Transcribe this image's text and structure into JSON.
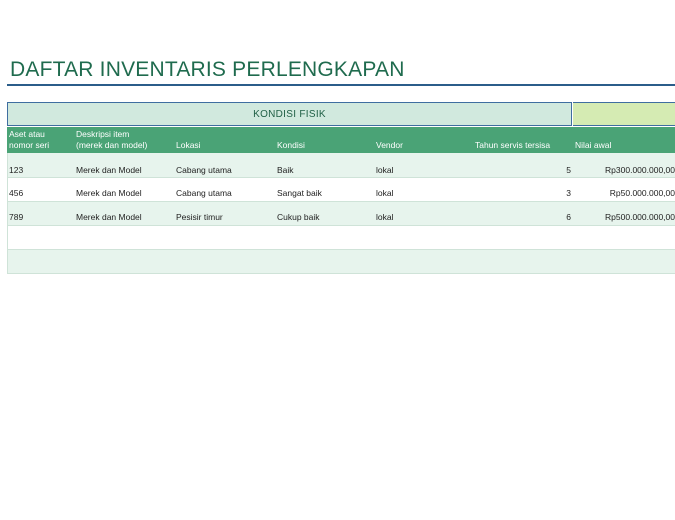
{
  "title": "DAFTAR INVENTARIS PERLENGKAPAN",
  "group_header": "KONDISI FISIK",
  "columns": [
    {
      "line1": "Aset atau",
      "line2": "nomor seri"
    },
    {
      "line1": "Deskripsi item",
      "line2": "(merek dan model)"
    },
    {
      "line1": "",
      "line2": "Lokasi"
    },
    {
      "line1": "",
      "line2": "Kondisi"
    },
    {
      "line1": "",
      "line2": "Vendor"
    },
    {
      "line1": "",
      "line2": "Tahun servis tersisa"
    },
    {
      "line1": "",
      "line2": "Nilai awal"
    }
  ],
  "rows": [
    {
      "asset": "123",
      "desc": "Merek dan Model",
      "location": "Cabang utama",
      "condition": "Baik",
      "vendor": "lokal",
      "years": "5",
      "value": "Rp300.000.000,00"
    },
    {
      "asset": "456",
      "desc": "Merek dan Model",
      "location": "Cabang utama",
      "condition": "Sangat baik",
      "vendor": "lokal",
      "years": "3",
      "value": "Rp50.000.000,00"
    },
    {
      "asset": "789",
      "desc": "Merek dan Model",
      "location": "Pesisir timur",
      "condition": "Cukup baik",
      "vendor": "lokal",
      "years": "6",
      "value": "Rp500.000.000,00"
    },
    {
      "asset": "",
      "desc": "",
      "location": "",
      "condition": "",
      "vendor": "",
      "years": "",
      "value": ""
    },
    {
      "asset": "",
      "desc": "",
      "location": "",
      "condition": "",
      "vendor": "",
      "years": "",
      "value": ""
    }
  ],
  "colors": {
    "title": "#1f6b4e",
    "header_bg": "#4aa376",
    "group_bg": "#d1e9de",
    "group_right_bg": "#d5ebb3",
    "row_alt_bg": "#e7f4ed",
    "accent_border": "#3f6ea0"
  }
}
